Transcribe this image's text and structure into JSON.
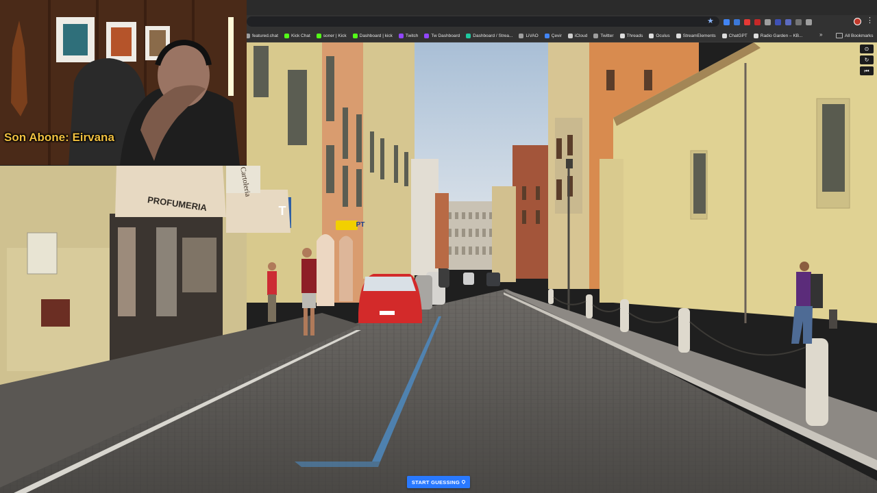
{
  "browser": {
    "bookmarks": [
      {
        "label": "featured.chat",
        "icon": "featured-chat-icon",
        "color": "#9e9e9e"
      },
      {
        "label": "Kick Chat",
        "icon": "kick-icon",
        "color": "#53fc18"
      },
      {
        "label": "soner | Kick",
        "icon": "kick-icon",
        "color": "#53fc18"
      },
      {
        "label": "Dashboard | kick",
        "icon": "kick-icon",
        "color": "#53fc18"
      },
      {
        "label": "Twitch",
        "icon": "twitch-icon",
        "color": "#9146ff"
      },
      {
        "label": "Tw Dashboard",
        "icon": "twitch-icon",
        "color": "#9146ff"
      },
      {
        "label": "Dashboard / Strea...",
        "icon": "streamelements-icon",
        "color": "#1ec9a0"
      },
      {
        "label": "LiVAO",
        "icon": "globe-icon",
        "color": "#9e9e9e"
      },
      {
        "label": "Çevir",
        "icon": "translate-icon",
        "color": "#4285f4"
      },
      {
        "label": "iCloud",
        "icon": "apple-icon",
        "color": "#cccccc"
      },
      {
        "label": "Twitter",
        "icon": "globe-icon",
        "color": "#9e9e9e"
      },
      {
        "label": "Threads",
        "icon": "threads-icon",
        "color": "#dddddd"
      },
      {
        "label": "Oculus",
        "icon": "oculus-icon",
        "color": "#dddddd"
      },
      {
        "label": "StreamElements",
        "icon": "streamelements-icon",
        "color": "#dddddd"
      },
      {
        "label": "ChatGPT",
        "icon": "chatgpt-icon",
        "color": "#dddddd"
      },
      {
        "label": "Radio Garden – KB...",
        "icon": "radio-icon",
        "color": "#dddddd"
      }
    ],
    "more_label": "»",
    "all_bookmarks_label": "All Bookmarks",
    "extension_colors": [
      "#4285f4",
      "#3c78d8",
      "#e53935",
      "#c62828",
      "#9e9e9e",
      "#3f51b5",
      "#5c6bc0",
      "#757575",
      "#9e9e9e"
    ]
  },
  "webcam": {
    "caption": "Son Abone: Eirvana",
    "caption_color": "#f0c040"
  },
  "scene": {
    "signs": {
      "profumeria": "PROFUMERIA",
      "cartoleria": "Cartoleria",
      "tabacchi": "T",
      "poste": "PT"
    }
  },
  "controls": {
    "start_label": "START GUESSING",
    "accent": "#2979ff"
  }
}
